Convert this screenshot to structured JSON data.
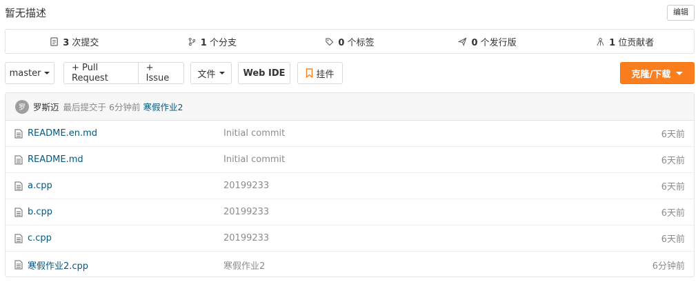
{
  "repo": {
    "description": "暂无描述",
    "edit_label": "编辑"
  },
  "stats": [
    {
      "icon": "commit-icon",
      "count": "3",
      "label": "次提交"
    },
    {
      "icon": "branch-icon",
      "count": "1",
      "label": "个分支"
    },
    {
      "icon": "tag-icon",
      "count": "0",
      "label": "个标签"
    },
    {
      "icon": "release-icon",
      "count": "0",
      "label": "个发行版"
    },
    {
      "icon": "contributors-icon",
      "count": "1",
      "label": "位贡献者"
    }
  ],
  "toolbar": {
    "branch": "master",
    "pull_request": "+ Pull Request",
    "issue": "+ Issue",
    "file": "文件",
    "web_ide": "Web IDE",
    "widget": "挂件",
    "clone": "克隆/下载",
    "accent_color": "#fa7e1e"
  },
  "last_commit": {
    "avatar_text": "罗",
    "author": "罗斯迈",
    "meta": "最后提交于 6分钟前",
    "message": "寒假作业2"
  },
  "files": [
    {
      "name": "README.en.md",
      "commit": "Initial commit",
      "time": "6天前"
    },
    {
      "name": "README.md",
      "commit": "Initial commit",
      "time": "6天前"
    },
    {
      "name": "a.cpp",
      "commit": "20199233",
      "time": "6天前"
    },
    {
      "name": "b.cpp",
      "commit": "20199233",
      "time": "6天前"
    },
    {
      "name": "c.cpp",
      "commit": "20199233",
      "time": "6天前"
    },
    {
      "name": "寒假作业2.cpp",
      "commit": "寒假作业2",
      "time": "6分钟前"
    }
  ]
}
